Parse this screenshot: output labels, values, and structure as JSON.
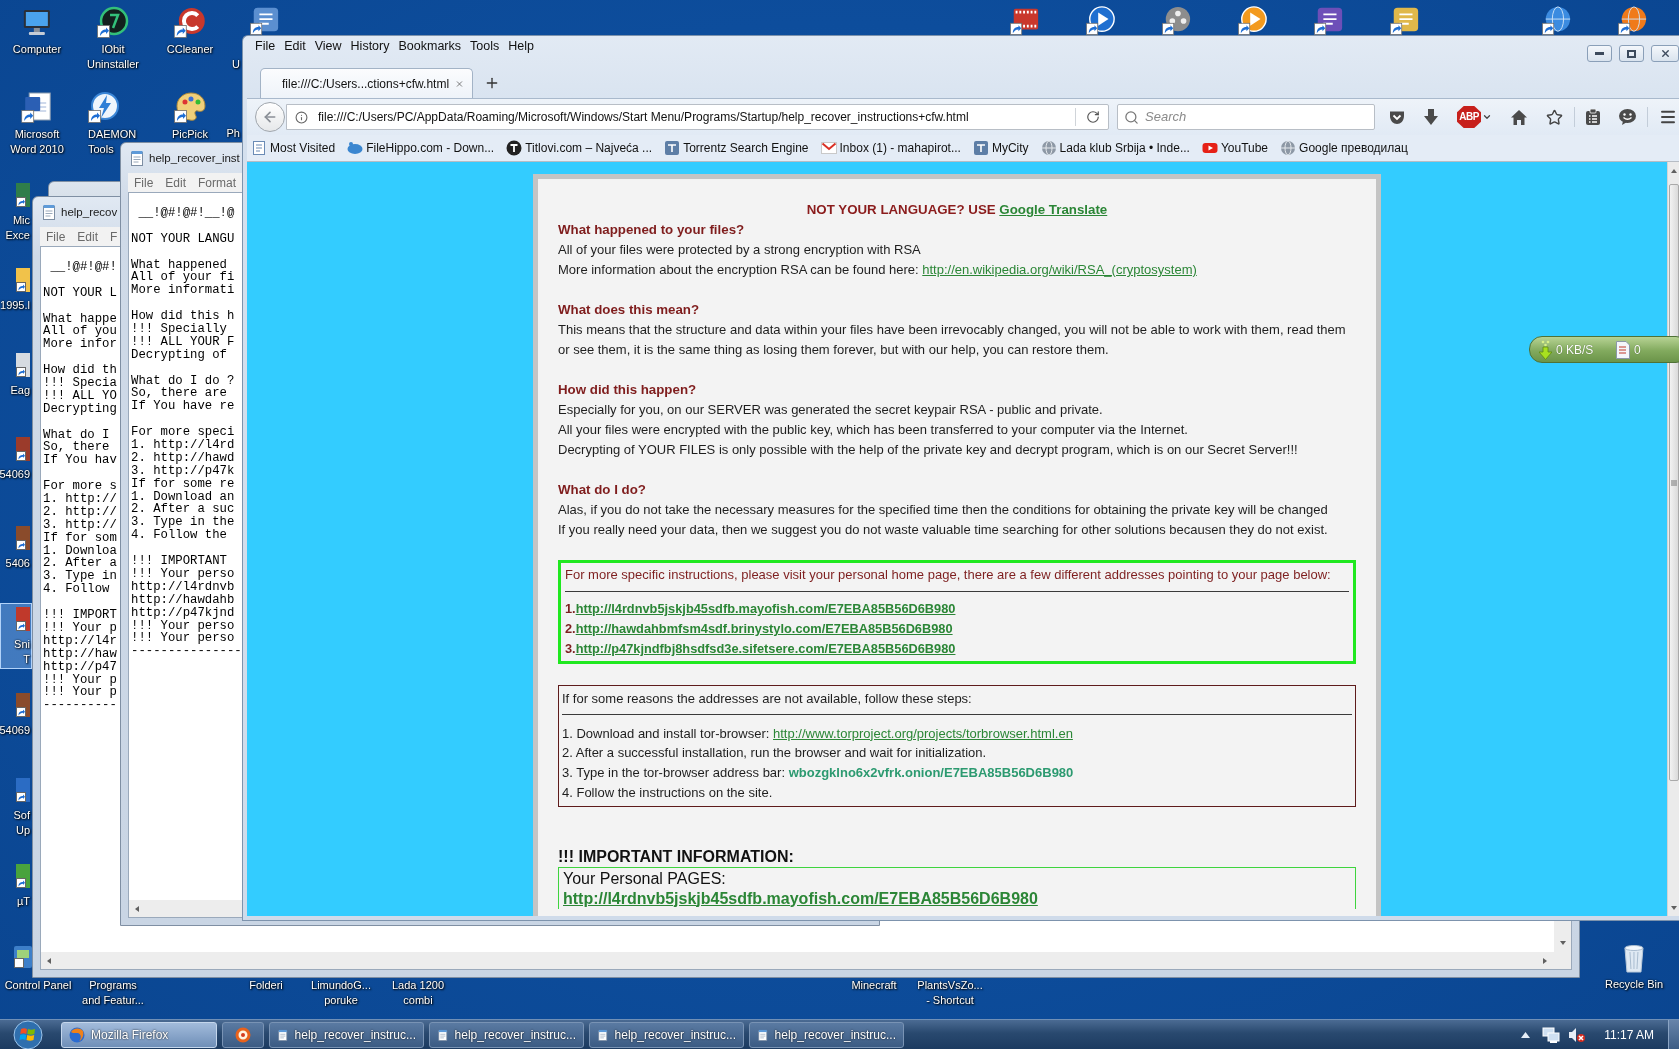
{
  "desktop": {
    "icons": [
      {
        "label_lines": [
          "Computer"
        ],
        "selected": false
      },
      {
        "label_lines": [
          "IObit",
          "Uninstaller"
        ],
        "selected": false
      },
      {
        "label_lines": [
          "CCleaner"
        ],
        "selected": false
      },
      {
        "label_lines": [
          "Microsoft",
          "Word 2010"
        ],
        "selected": false
      },
      {
        "label_lines": [
          "DAEMON",
          "Tools"
        ],
        "selected": false
      },
      {
        "label_lines": [
          "PicPick"
        ],
        "selected": false
      },
      {
        "label_lines": [
          "Control Panel"
        ],
        "selected": false
      },
      {
        "label_lines": [
          "Programs",
          "and Featur..."
        ],
        "selected": false
      },
      {
        "label_lines": [
          "Folderi"
        ],
        "selected": false
      },
      {
        "label_lines": [
          "LimundoG...",
          "poruke"
        ],
        "selected": false
      },
      {
        "label_lines": [
          "Lada 1200",
          "combi"
        ],
        "selected": false
      },
      {
        "label_lines": [
          "Minecraft"
        ],
        "selected": false
      },
      {
        "label_lines": [
          "PlantsVsZo...",
          "- Shortcut"
        ],
        "selected": false
      },
      {
        "label_lines": [
          "Recycle Bin"
        ],
        "selected": false
      }
    ],
    "partly_hidden_icons": [
      {
        "label_lines": [
          "Mic",
          "Exce"
        ],
        "selected": false
      },
      {
        "label_lines": [
          "1995.l"
        ],
        "selected": false
      },
      {
        "label_lines": [
          "Eag"
        ],
        "selected": false
      },
      {
        "label_lines": [
          "54069"
        ],
        "selected": false
      },
      {
        "label_lines": [
          "5406"
        ],
        "selected": false
      },
      {
        "label_lines": [
          "Sni",
          "T"
        ],
        "selected": true
      },
      {
        "label_lines": [
          "54069"
        ],
        "selected": false
      },
      {
        "label_lines": [
          "Sof",
          "Up"
        ],
        "selected": false
      },
      {
        "label_lines": [
          "µT"
        ],
        "selected": false
      },
      {
        "label_lines": [
          "U"
        ],
        "selected": false
      },
      {
        "label_lines": [
          "Ph"
        ],
        "selected": false
      }
    ]
  },
  "notepad_windows": [
    {
      "title": "help_recov",
      "menu": [
        "File",
        "Edit",
        "F"
      ],
      "blocks": [
        [
          " __!@#!@#!"
        ],
        [
          "NOT YOUR L"
        ],
        [
          "What happe",
          "All of you",
          "More infor"
        ],
        [
          "How did th",
          "!!! Specia",
          "!!! ALL YO",
          "Decrypting"
        ],
        [
          "What do I",
          "So, there",
          "If You hav"
        ],
        [
          "For more s",
          "1. http://",
          "2. http://",
          "3. http://",
          "If for som",
          "1. Downloa",
          "2. After a",
          "3. Type in",
          "4. Follow"
        ],
        [
          "!!! IMPORT",
          "!!! Your p",
          "http://l4r",
          "http://haw",
          "http://p47",
          "!!! Your p",
          "!!! Your p",
          "----------"
        ]
      ]
    },
    {
      "title": "help_recover_inst",
      "menu": [
        "File",
        "Edit",
        "Format"
      ],
      "blocks": [
        [
          " __!@#!@#!__!@"
        ],
        [
          "NOT YOUR LANGU"
        ],
        [
          "What happened",
          "All of your fi",
          "More informati"
        ],
        [
          "How did this h",
          "!!! Specially",
          "!!! ALL YOUR F",
          "Decrypting of"
        ],
        [
          "What do I do ?",
          "So, there are",
          "If You have re"
        ],
        [
          "For more speci",
          "1. http://l4rd",
          "2. http://hawd",
          "3. http://p47k",
          "If for some re",
          "1. Download an",
          "2. After a suc",
          "3. Type in the",
          "4. Follow the"
        ],
        [
          "!!! IMPORTANT",
          "!!! Your perso",
          "http://l4rdnvb",
          "http://hawdahb",
          "http://p47kjnd",
          "!!! Your perso",
          "!!! Your perso",
          "---------------"
        ]
      ]
    }
  ],
  "browser": {
    "menu": [
      "File",
      "Edit",
      "View",
      "History",
      "Bookmarks",
      "Tools",
      "Help"
    ],
    "tabs": [
      {
        "title": "file:///C:/Users...ctions+cfw.html",
        "selected": true
      }
    ],
    "address": "file:///C:/Users/PC/AppData/Roaming/Microsoft/Windows/Start Menu/Programs/Startup/help_recover_instructions+cfw.html",
    "search": {
      "placeholder": "Search"
    },
    "adblock_label": "ABP",
    "bookmarks": [
      "Most Visited",
      "FileHippo.com - Down...",
      "Titlovi.com – Najveća ...",
      "Torrentz Search Engine",
      "Inbox (1) - mahapirot...",
      "MyCity",
      "Lada klub Srbija • Inde...",
      "YouTube",
      "Google преводилац"
    ],
    "page": {
      "language_notice": {
        "text": "NOT YOUR LANGUAGE? USE",
        "link": "Google Translate"
      },
      "sections": [
        {
          "heading": "What happened to your files?",
          "lines": [
            {
              "text": "All of your files were protected by a strong encryption with RSA"
            },
            {
              "text": "More information about the encryption RSA can be found here:",
              "link": "http://en.wikipedia.org/wiki/RSA_(cryptosystem)"
            }
          ]
        },
        {
          "heading": "What does this mean?",
          "lines": [
            {
              "text": "This means that the structure and data within your files have been irrevocably changed, you will not be able to work with them, read them"
            },
            {
              "text": "or see them, it is the same thing as losing them forever, but with our help, you can restore them."
            }
          ]
        },
        {
          "heading": "How did this happen?",
          "lines": [
            {
              "text": "Especially for you, on our SERVER was generated the secret keypair RSA - public and private."
            },
            {
              "text": "All your files were encrypted with the public key, which has been transferred to your computer via the Internet."
            },
            {
              "text": "Decrypting of YOUR FILES is only possible with the help of the private key and decrypt program, which is on our Secret Server!!!"
            }
          ]
        },
        {
          "heading": "What do I do?",
          "lines": [
            {
              "text": "Alas, if you do not take the necessary measures for the specified time then the conditions for obtaining the private key will be changed"
            },
            {
              "text": "If you really need your data, then we suggest you do not waste valuable time searching for other solutions becausen they do not exist."
            }
          ]
        }
      ],
      "addresses_box": {
        "intro": "For more specific instructions, please visit your personal home page, there are a few different addresses pointing to your page below:",
        "links": [
          {
            "number": "1.",
            "url": "http://l4rdnvb5jskjb45sdfb.mayofish.com/E7EBA85B56D6B980"
          },
          {
            "number": "2.",
            "url": "http://hawdahbmfsm4sdf.brinystylo.com/E7EBA85B56D6B980"
          },
          {
            "number": "3.",
            "url": "http://p47kjndfbj8hsdfsd3e.sifetsere.com/E7EBA85B56D6B980"
          }
        ]
      },
      "steps_box": {
        "intro": "If for some reasons the addresses are not available, follow these steps:",
        "steps": [
          {
            "text": "1. Download and install tor-browser:",
            "link": "http://www.torproject.org/projects/torbrowser.html.en"
          },
          {
            "text": "2. After a successful installation, run the browser and wait for initialization."
          },
          {
            "text": "3. Type in the tor-browser address bar:",
            "address": "wbozgklno6x2vfrk.onion/E7EBA85B56D6B980"
          },
          {
            "text": "4. Follow the instructions on the site."
          }
        ]
      },
      "important": {
        "heading": "!!! IMPORTANT INFORMATION:",
        "pages_label": "Your Personal PAGES:",
        "link": "http://l4rdnvb5jskjb45sdfb.mayofish.com/E7EBA85B56D6B980"
      }
    }
  },
  "download_widget": {
    "speed": "0 KB/S",
    "count": "0"
  },
  "taskbar": {
    "buttons": [
      {
        "kind": "program",
        "label": "Mozilla Firefox",
        "selected": true
      },
      {
        "kind": "pinned",
        "selected": false
      },
      {
        "kind": "program",
        "label": "help_recover_instruc...",
        "selected": false
      },
      {
        "kind": "program",
        "label": "help_recover_instruc...",
        "selected": false
      },
      {
        "kind": "program",
        "label": "help_recover_instruc...",
        "selected": false
      },
      {
        "kind": "program",
        "label": "help_recover_instruc...",
        "selected": false
      }
    ],
    "time": "11:17 AM"
  }
}
